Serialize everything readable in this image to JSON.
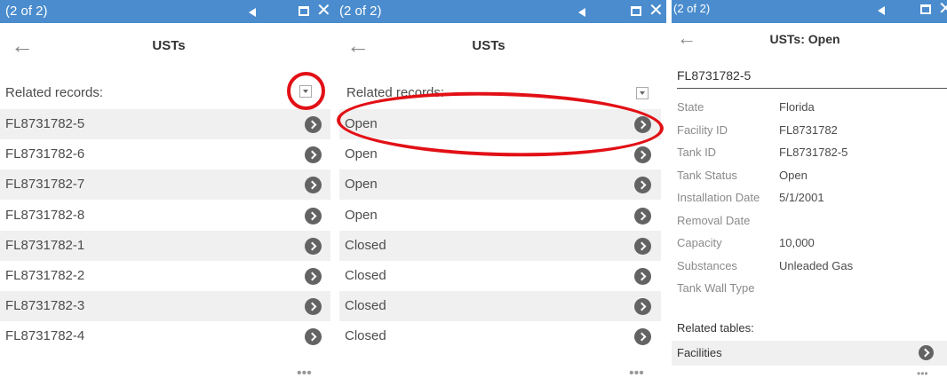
{
  "panel1": {
    "count": "(2 of 2)",
    "title": "USTs",
    "related_label": "Related records:",
    "rows": [
      "FL8731782-5",
      "FL8731782-6",
      "FL8731782-7",
      "FL8731782-8",
      "FL8731782-1",
      "FL8731782-2",
      "FL8731782-3",
      "FL8731782-4"
    ],
    "more": "•••"
  },
  "panel2": {
    "count": "(2 of 2)",
    "title": "USTs",
    "related_label": "Related records:",
    "rows": [
      "Open",
      "Open",
      "Open",
      "Open",
      "Closed",
      "Closed",
      "Closed",
      "Closed"
    ],
    "more": "•••"
  },
  "panel3": {
    "count": "(2 of 2)",
    "title": "USTs: Open",
    "record_id": "FL8731782-5",
    "attributes": [
      {
        "key": "State",
        "value": "Florida"
      },
      {
        "key": "Facility ID",
        "value": "FL8731782"
      },
      {
        "key": "Tank ID",
        "value": "FL8731782-5"
      },
      {
        "key": "Tank Status",
        "value": "Open"
      },
      {
        "key": "Installation Date",
        "value": "5/1/2001"
      },
      {
        "key": "Removal Date",
        "value": ""
      },
      {
        "key": "Capacity",
        "value": "10,000"
      },
      {
        "key": "Substances",
        "value": "Unleaded Gas"
      },
      {
        "key": "Tank Wall Type",
        "value": ""
      }
    ],
    "related_tables_label": "Related tables:",
    "related_tables": [
      "Facilities"
    ],
    "more": "•••"
  },
  "icons": {
    "back": "back-arrow-icon",
    "prev": "previous-triangle-icon",
    "maximize": "maximize-icon",
    "close": "close-icon",
    "chevron": "chevron-right-circle-icon",
    "dropdown": "dropdown-icon"
  },
  "colors": {
    "titlebar": "#4a8ccd",
    "highlight": "#e21016",
    "row_alt": "#f0f0f0",
    "chevron": "#636363"
  }
}
